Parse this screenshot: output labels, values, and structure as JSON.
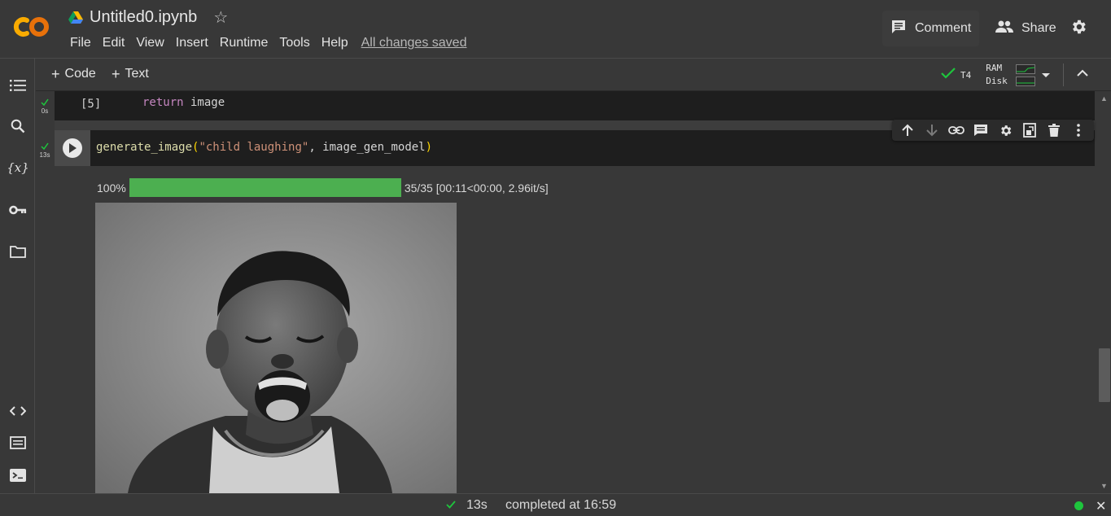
{
  "app": {
    "title": "Untitled0.ipynb",
    "brand_color": "#f9ab00",
    "menu": [
      "File",
      "Edit",
      "View",
      "Insert",
      "Runtime",
      "Tools",
      "Help"
    ],
    "save_status": "All changes saved",
    "comment_label": "Comment",
    "share_label": "Share",
    "icons": {
      "logo": "colab-logo",
      "drive": "drive-icon",
      "star": "star-icon",
      "comment": "comment-icon",
      "share": "people-icon",
      "settings": "gear-icon"
    }
  },
  "rail": {
    "items": [
      {
        "icon": "table-of-contents-icon"
      },
      {
        "icon": "search-icon"
      },
      {
        "icon": "variables-icon",
        "label": "{x}"
      },
      {
        "icon": "key-icon"
      },
      {
        "icon": "folder-icon"
      },
      {
        "icon": "code-snippets-icon"
      },
      {
        "icon": "command-palette-icon"
      },
      {
        "icon": "terminal-icon"
      }
    ]
  },
  "toolbar": {
    "add_code": "Code",
    "add_text": "Text",
    "runtime_status_color": "#1ec53d",
    "gpu": "T4",
    "ram_label": "RAM",
    "disk_label": "Disk"
  },
  "cells": [
    {
      "status": "ok",
      "exec_time": "0s",
      "prompt": "[5]",
      "code_keyword": "return",
      "code_rest": " image"
    },
    {
      "status": "ok",
      "exec_time": "13s",
      "code": {
        "fn": "generate_image",
        "open": "(",
        "arg_str": "\"child laughing\"",
        "sep": ", ",
        "arg_var": "image_gen_model",
        "close": ")"
      },
      "output": {
        "progress_percent_label": "100%",
        "progress_fraction": 1.0,
        "progress_detail": "35/35 [00:11<00:00, 2.96it/s]",
        "progress_color": "#4caf50",
        "image": "grayscale photo of a laughing child"
      }
    }
  ],
  "cell_toolbar": [
    "arrow-up-icon",
    "arrow-down-icon",
    "link-icon",
    "comment-icon",
    "gear-icon",
    "mirror-cell-icon",
    "trash-icon",
    "more-vert-icon"
  ],
  "statusbar": {
    "check": "✓",
    "time": "13s",
    "completed": "completed at 16:59",
    "connection_color": "#1ec53d"
  }
}
